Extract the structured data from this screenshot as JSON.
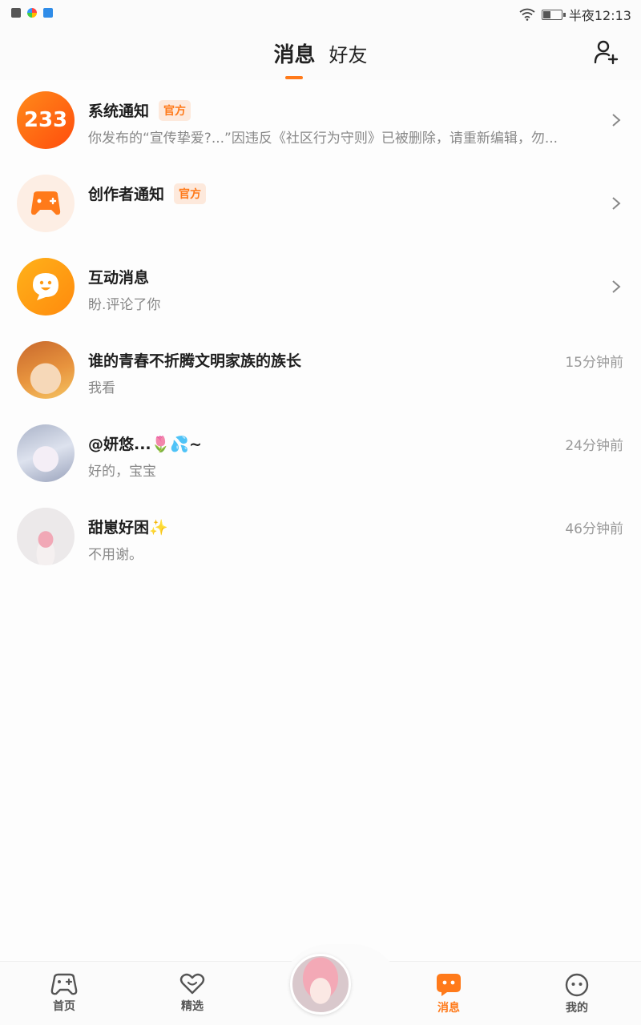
{
  "status_bar": {
    "time": "半夜12:13"
  },
  "header": {
    "tabs": [
      {
        "label": "消息",
        "active": true
      },
      {
        "label": "好友",
        "active": false
      }
    ],
    "add_friend_icon": "add-user-icon"
  },
  "messages": [
    {
      "title": "系统通知",
      "badge": "官方",
      "subtitle": "你发布的“宣传挚爱?...”因违反《社区行为守则》已被删除，请重新编辑，勿...",
      "has_chevron": true,
      "avatar_text": "233"
    },
    {
      "title": "创作者通知",
      "badge": "官方",
      "subtitle": "",
      "has_chevron": true
    },
    {
      "title": "互动消息",
      "subtitle": "盼.评论了你",
      "has_chevron": true
    },
    {
      "title": "谁的青春不折腾文明家族的族长",
      "subtitle": "我看",
      "time": "15分钟前"
    },
    {
      "title": "@妍悠...🌷💦~",
      "subtitle": "好的，宝宝",
      "time": "24分钟前"
    },
    {
      "title": "甜崽好困✨",
      "subtitle": "不用谢。",
      "time": "46分钟前"
    }
  ],
  "bottom_nav": {
    "items": [
      {
        "label": "首页",
        "icon": "gamepad-icon",
        "active": false
      },
      {
        "label": "精选",
        "icon": "heart-icon",
        "active": false
      },
      {
        "label": "消息",
        "icon": "message-icon",
        "active": true
      },
      {
        "label": "我的",
        "icon": "face-icon",
        "active": false
      }
    ]
  },
  "colors": {
    "accent": "#ff7a1a",
    "badge_bg": "#fde9dc"
  }
}
